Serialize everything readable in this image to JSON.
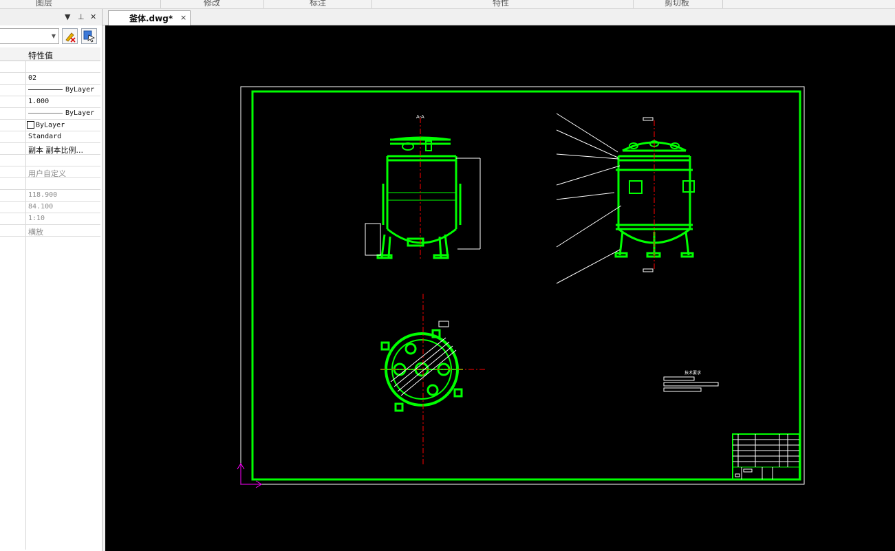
{
  "ribbon": {
    "groups": [
      "图层",
      "修改",
      "标注",
      "特性",
      "剪切板"
    ]
  },
  "properties_panel": {
    "icons": [
      "dropdown-icon",
      "pin-icon",
      "close-icon"
    ],
    "header": "特性值",
    "rows": [
      {
        "value": ""
      },
      {
        "value": "02"
      },
      {
        "value": "ByLayer",
        "kind": "linetype"
      },
      {
        "value": "1.000"
      },
      {
        "value": "ByLayer",
        "kind": "lineweight"
      },
      {
        "value": "ByLayer",
        "kind": "color"
      },
      {
        "value": "Standard"
      },
      {
        "value": "副本 副本比例..."
      },
      {
        "value": ""
      },
      {
        "value": "用户自定义",
        "grey": true
      },
      {
        "value": "",
        "grey": true
      },
      {
        "value": "118.900",
        "grey": true
      },
      {
        "value": "84.100",
        "grey": true
      },
      {
        "value": "1:10",
        "grey": true
      },
      {
        "value": "横放",
        "grey": true
      }
    ]
  },
  "document_tab": {
    "title": "釜体.dwg*",
    "close": "×"
  },
  "drawing": {
    "section_label": "A-A",
    "tech_requirements_title": "技术要求",
    "colors": {
      "background": "#000000",
      "frame": "#00ff00",
      "sheet": "#ffffff",
      "centerline": "#ff0000",
      "ucs": "#ff00ff"
    }
  }
}
